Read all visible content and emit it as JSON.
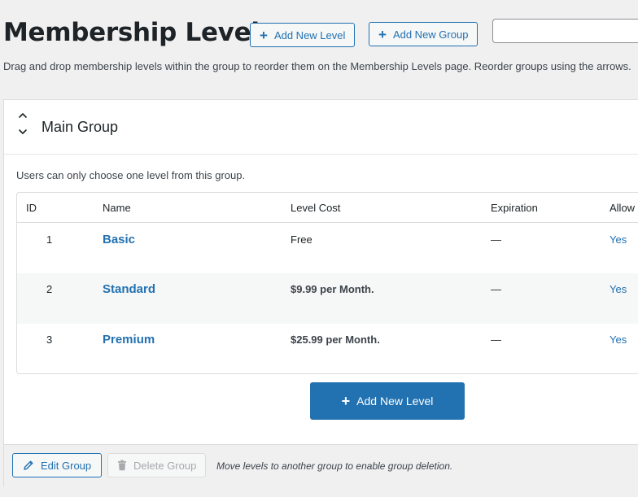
{
  "header": {
    "title": "Membership Levels",
    "add_level_label": "Add New Level",
    "add_group_label": "Add New Group",
    "search_value": ""
  },
  "instructions": "Drag and drop membership levels within the group to reorder them on the Membership Levels page. Reorder groups using the arrows.",
  "group": {
    "title": "Main Group",
    "note": "Users can only choose one level from this group.",
    "table": {
      "headers": [
        "ID",
        "Name",
        "Level Cost",
        "Expiration",
        "Allow Signups"
      ],
      "rows": [
        {
          "id": "1",
          "name": "Basic",
          "cost": "Free",
          "expiration": "—",
          "allow": "Yes"
        },
        {
          "id": "2",
          "name": "Standard",
          "cost": "$9.99 per Month.",
          "expiration": "—",
          "allow": "Yes"
        },
        {
          "id": "3",
          "name": "Premium",
          "cost": "$25.99 per Month.",
          "expiration": "—",
          "allow": "Yes"
        }
      ]
    },
    "add_level_label": "Add New Level",
    "edit_group_label": "Edit Group",
    "delete_group_label": "Delete Group",
    "footer_note": "Move levels to another group to enable group deletion."
  },
  "colors": {
    "accent": "#2271b1",
    "background": "#f0f0f1",
    "disabled": "#a7aaad"
  },
  "icons": {
    "add": "plus-icon",
    "sort": "chevron-up-down-icon",
    "edit": "pencil-icon",
    "delete": "trash-icon"
  }
}
